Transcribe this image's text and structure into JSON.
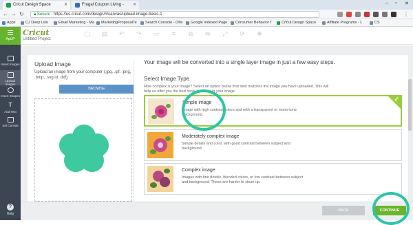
{
  "browser": {
    "tabs": [
      {
        "label": "Cricut Design Space",
        "active": true
      },
      {
        "label": "Frugal Coupon Living -",
        "active": false
      }
    ],
    "url_secure": "Secure",
    "url": "https://us.cricut.com/design/#/canvas/upload-image-basic-1",
    "bookmarks": [
      "Apps",
      "CJ Deep Link",
      "Email Marketing - Ma",
      "MarketingProposalTe",
      "Search Console - Ofte",
      "Google Indexed Page",
      "Consumer Behavior T",
      "Cricut Design Space",
      "Affiliate Programs - L",
      "CS"
    ]
  },
  "app": {
    "logo": "Cricut",
    "project_name": "Untitled Project",
    "menu_label": "ApUP"
  },
  "sidebar": {
    "items": [
      {
        "label": "Insert Images"
      },
      {
        "label": "Upload Images"
      },
      {
        "label": "Insert Shapes"
      },
      {
        "label": "Add Text"
      },
      {
        "label": "Set Canvas"
      }
    ],
    "help": "Help"
  },
  "upload": {
    "title": "Upload Image",
    "description": "Upload an image from your computer (.jpg, .gif, .png, .bmp, .svg or .dxf).",
    "browse_label": "BROWSE"
  },
  "convert": {
    "headline": "Your image will be converted into a single layer image in just a few easy steps.",
    "select_type": "Select Image Type",
    "select_desc": "How complex is your image? Select an option below that best matches the image you have uploaded. This will help us offer you the best tools to clean up your image.",
    "options": [
      {
        "title": "Simple image",
        "desc": "Image with high contrast colors and with a transparent or mono-tone background.",
        "selected": true
      },
      {
        "title": "Moderately complex image",
        "desc": "Simple details and color, with good contrast between subject and background.",
        "selected": false
      },
      {
        "title": "Complex image",
        "desc": "Images with fine details, blended colors, or low contrast between subject and background. These are harder to clean up.",
        "selected": false
      }
    ]
  },
  "footer": {
    "back_label": "BACK",
    "continue_label": "CONTINUE"
  },
  "colors": {
    "accent_green": "#6bb52c",
    "highlight_ring": "#2ec4a6",
    "shape_teal": "#3ec9a0"
  }
}
